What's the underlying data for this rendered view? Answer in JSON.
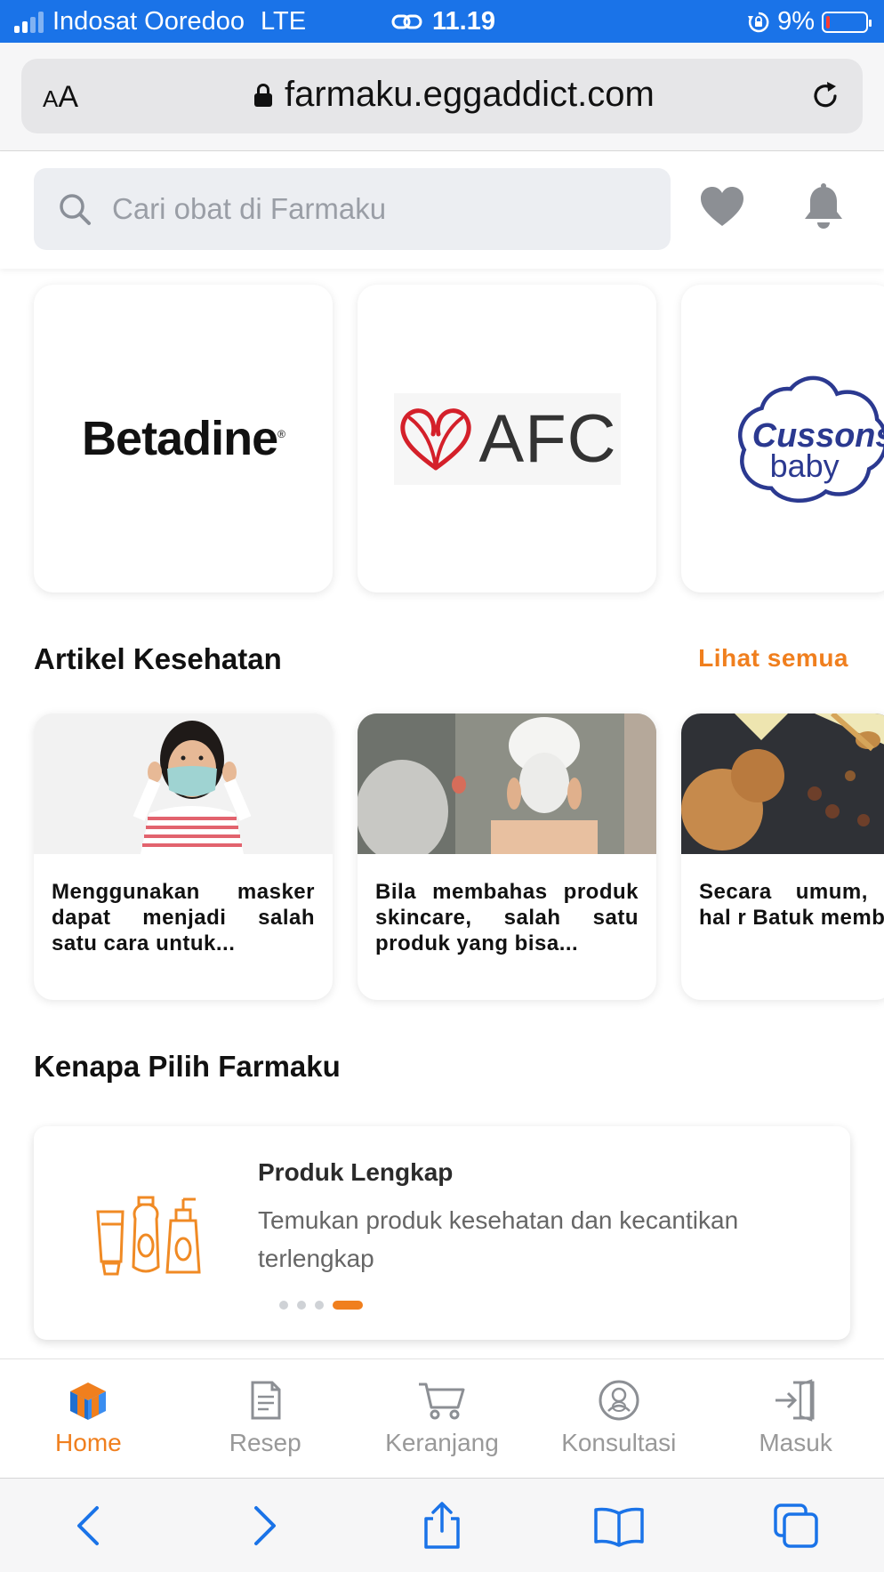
{
  "status_bar": {
    "carrier": "Indosat Ooredoo",
    "network": "LTE",
    "time": "11.19",
    "battery_percent": "9%",
    "battery_level": 0.09
  },
  "browser": {
    "text_size_label": "AA",
    "url": "farmaku.eggaddict.com",
    "icons": [
      "text-size-icon",
      "lock-icon",
      "reload-icon"
    ]
  },
  "header": {
    "search_placeholder": "Cari obat di Farmaku",
    "icons": [
      "search-icon",
      "heart-icon",
      "bell-icon"
    ]
  },
  "brands": [
    {
      "name": "Betadine"
    },
    {
      "name": "AFC"
    },
    {
      "name": "Cussons baby",
      "line1": "Cussons",
      "line2": "baby"
    }
  ],
  "articles_section": {
    "title": "Artikel Kesehatan",
    "see_all": "Lihat semua",
    "items": [
      {
        "excerpt": "Menggunakan masker dapat menjadi salah satu cara untuk..."
      },
      {
        "excerpt": "Bila membahas produk skincare, salah satu produk yang bisa..."
      },
      {
        "excerpt": "Secara umum, adalah hal r Batuk membantu"
      }
    ]
  },
  "why_section": {
    "title": "Kenapa Pilih Farmaku",
    "card_title": "Produk Lengkap",
    "card_desc": "Temukan produk kesehatan dan kecantikan terlengkap",
    "slides": 4,
    "active_slide": 4,
    "accent_color": "#f07f1e"
  },
  "bottom_nav": {
    "items": [
      {
        "label": "Home",
        "icon": "home-icon",
        "active": true
      },
      {
        "label": "Resep",
        "icon": "prescription-icon",
        "active": false
      },
      {
        "label": "Keranjang",
        "icon": "cart-icon",
        "active": false
      },
      {
        "label": "Konsultasi",
        "icon": "consultation-icon",
        "active": false
      },
      {
        "label": "Masuk",
        "icon": "login-icon",
        "active": false
      }
    ]
  },
  "safari_toolbar": {
    "icons": [
      "back-icon",
      "forward-icon",
      "share-icon",
      "bookmarks-icon",
      "tabs-icon"
    ]
  }
}
